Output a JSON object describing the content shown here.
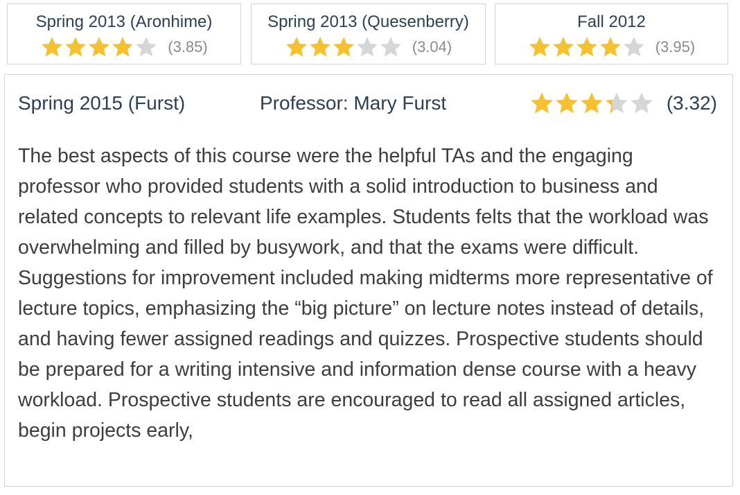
{
  "term_cards": [
    {
      "term": "Spring 2013 (Aronhime)",
      "rating": 3.85,
      "rating_text": "(3.85)"
    },
    {
      "term": "Spring 2013 (Quesenberry)",
      "rating": 3.04,
      "rating_text": "(3.04)"
    },
    {
      "term": "Fall 2012",
      "rating": 3.95,
      "rating_text": "(3.95)"
    }
  ],
  "main": {
    "term": "Spring 2015 (Furst)",
    "professor": "Professor: Mary Furst",
    "rating": 3.32,
    "rating_text": "(3.32)",
    "review": "The best aspects of this course were the helpful TAs and the engaging professor who provided students with a solid introduction to business and related concepts to relevant life examples. Students felts that the workload was overwhelming and filled by busywork, and that the exams were difficult. Suggestions for improvement included making midterms more representative of lecture topics, emphasizing the “big picture” on lecture notes instead of details, and having fewer assigned readings and quizzes. Prospective students should be prepared for a writing intensive and information dense course with a heavy workload. Prospective students are encouraged to read all assigned articles, begin projects early,"
  },
  "colors": {
    "star_filled": "#f6c131",
    "star_empty": "#d6d6d6",
    "heading": "#2d3f55",
    "body_text": "#3d3d3d",
    "muted": "#8a8a8a",
    "border": "#d4d4d4"
  },
  "icons": {
    "star": "star-icon"
  }
}
